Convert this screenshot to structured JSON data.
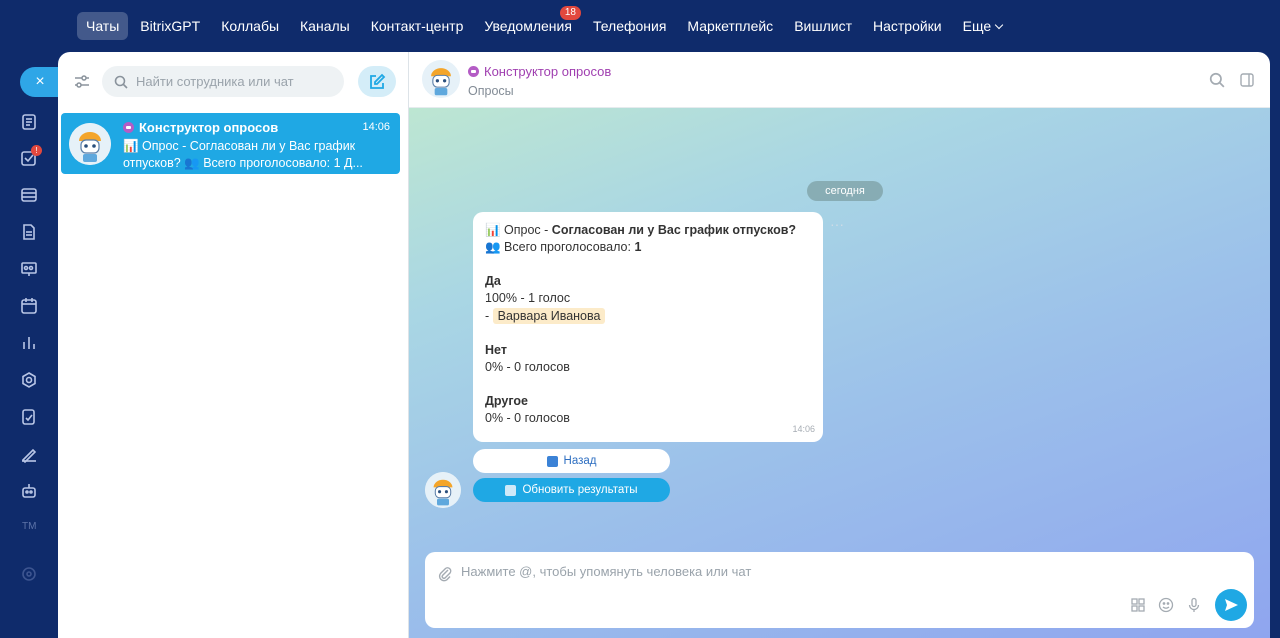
{
  "nav": {
    "items": [
      {
        "label": "Чаты",
        "active": true
      },
      {
        "label": "BitrixGPT"
      },
      {
        "label": "Коллабы"
      },
      {
        "label": "Каналы"
      },
      {
        "label": "Контакт-центр"
      },
      {
        "label": "Уведомления",
        "badge": "18"
      },
      {
        "label": "Телефония"
      },
      {
        "label": "Маркетплейс"
      },
      {
        "label": "Вишлист"
      },
      {
        "label": "Настройки"
      },
      {
        "label": "Еще"
      }
    ]
  },
  "rail": {
    "close_label": "×",
    "tasks_badge": "!",
    "bottom_text": "TM"
  },
  "chat_list": {
    "search_placeholder": "Найти сотрудника или чат",
    "items": [
      {
        "title": "Конструктор опросов",
        "time": "14:06",
        "preview": "📊 Опрос - Согласован ли у Вас график отпусков? 👥 Всего проголосовало: 1 Д..."
      }
    ]
  },
  "header": {
    "title": "Конструктор опросов",
    "subtitle": "Опросы"
  },
  "messages": {
    "date": "сегодня",
    "poll": {
      "line1_prefix": "📊 Опрос - ",
      "question": "Согласован ли у Вас график отпусков?",
      "line2_prefix": "👥 Всего проголосовало: ",
      "total": "1",
      "option1_label": "Да",
      "option1_result": "100% - 1 голос",
      "option1_voter_prefix": "- ",
      "option1_voter": "Варвара Иванова",
      "option2_label": "Нет",
      "option2_result": "0% - 0 голосов",
      "option3_label": "Другое",
      "option3_result": "0% - 0 голосов",
      "time": "14:06"
    },
    "buttons": {
      "back": "Назад",
      "refresh": "Обновить результаты"
    }
  },
  "composer": {
    "placeholder": "Нажмите @, чтобы упомянуть человека или чат"
  },
  "colors": {
    "accent": "#1fa8e4",
    "bot_name": "#a03fb0",
    "nav_bg": "#0f2b6b",
    "badge": "#e2483e"
  }
}
